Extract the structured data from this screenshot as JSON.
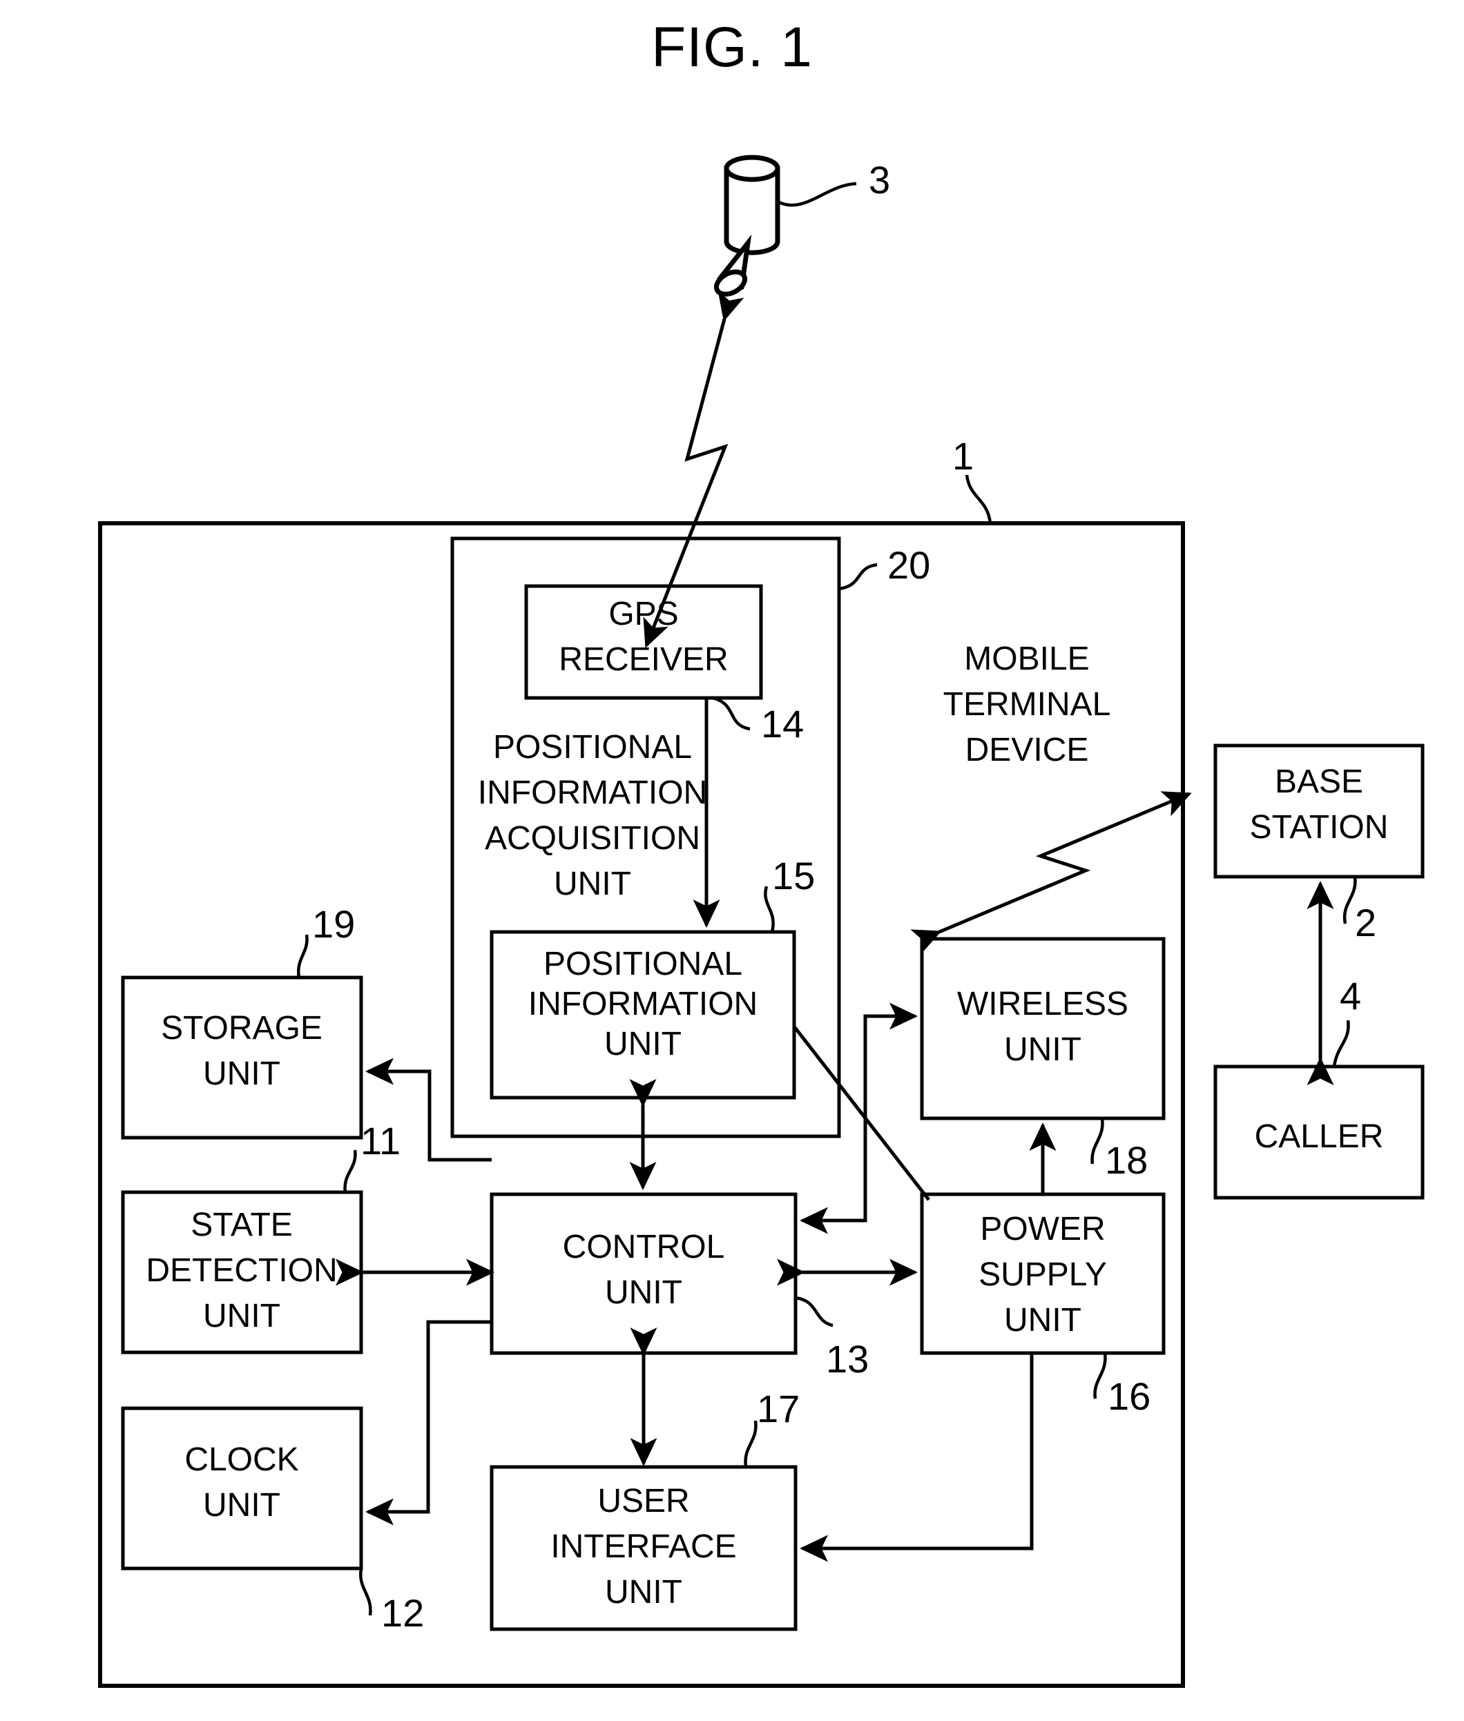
{
  "figure": {
    "title": "FIG. 1",
    "type": "patent-block-diagram"
  },
  "free_text": {
    "mobile_terminal_device": [
      "MOBILE",
      "TERMINAL",
      "DEVICE"
    ],
    "positional_information_acquisition_unit": [
      "POSITIONAL",
      "INFORMATION",
      "ACQUISITION",
      "UNIT"
    ]
  },
  "boxes": {
    "gps_receiver": {
      "lines": [
        "GPS",
        "RECEIVER"
      ],
      "ref": "14"
    },
    "positional_information_unit": {
      "lines": [
        "POSITIONAL",
        "INFORMATION",
        "UNIT"
      ],
      "ref": "15"
    },
    "storage_unit": {
      "lines": [
        "STORAGE",
        "UNIT"
      ],
      "ref": "19"
    },
    "state_detection_unit": {
      "lines": [
        "STATE",
        "DETECTION",
        "UNIT"
      ],
      "ref": "11"
    },
    "clock_unit": {
      "lines": [
        "CLOCK",
        "UNIT"
      ],
      "ref": "12"
    },
    "control_unit": {
      "lines": [
        "CONTROL",
        "UNIT"
      ],
      "ref": "13"
    },
    "user_interface_unit": {
      "lines": [
        "USER",
        "INTERFACE",
        "UNIT"
      ],
      "ref": "17"
    },
    "wireless_unit": {
      "lines": [
        "WIRELESS",
        "UNIT"
      ],
      "ref": "18"
    },
    "power_supply_unit": {
      "lines": [
        "POWER",
        "SUPPLY",
        "UNIT"
      ],
      "ref": "16"
    },
    "base_station": {
      "lines": [
        "BASE",
        "STATION"
      ],
      "ref": "2"
    },
    "caller": {
      "lines": [
        "CALLER"
      ],
      "ref": "4"
    }
  },
  "reference_numerals": {
    "mobile_terminal_device": "1",
    "base_station": "2",
    "gps_satellite": "3",
    "caller": "4",
    "state_detection_unit": "11",
    "clock_unit": "12",
    "control_unit": "13",
    "gps_receiver": "14",
    "positional_information_unit": "15",
    "power_supply_unit": "16",
    "user_interface_unit": "17",
    "wireless_unit": "18",
    "storage_unit": "19",
    "positional_information_acquisition_unit": "20"
  },
  "icons": {
    "gps_satellite": "satellite-icon",
    "wireless_link": "lightning-bolt-arrow-icon"
  },
  "colors": {
    "ink": "#000000",
    "paper": "#ffffff"
  }
}
